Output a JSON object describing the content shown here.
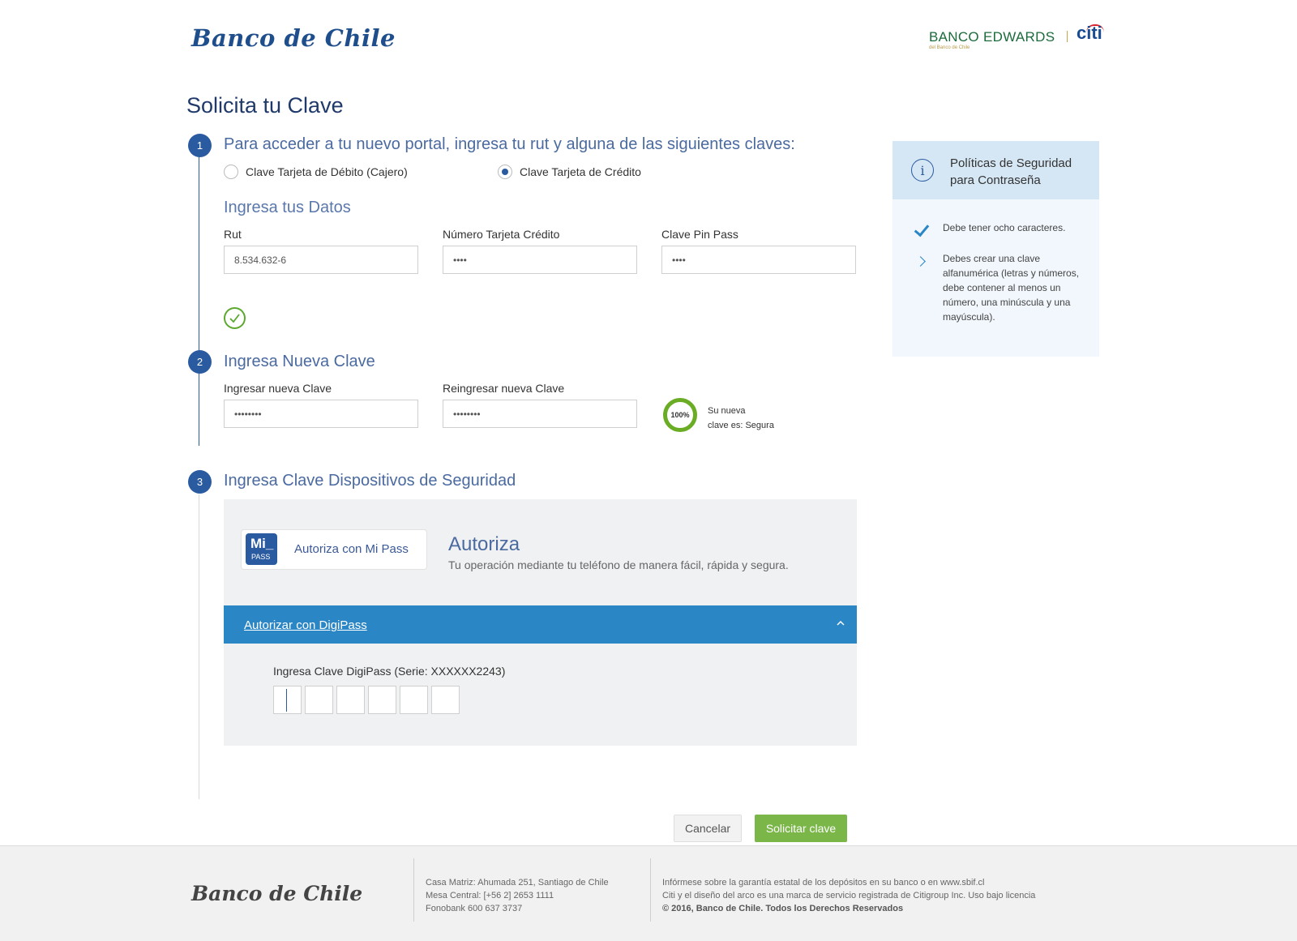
{
  "header": {
    "logo_left": "Banco de Chile",
    "logo_right_main": "BANCO EDWARDS",
    "logo_right_sub": "del Banco de Chile",
    "logo_citi": "citi"
  },
  "page_title": "Solicita tu Clave",
  "step1": {
    "number": "1",
    "heading": "Para acceder a tu nuevo portal, ingresa tu rut y alguna de las siguientes claves:",
    "options": [
      {
        "label": "Clave Tarjeta de Débito (Cajero)",
        "selected": false
      },
      {
        "label": "Clave Tarjeta de Crédito",
        "selected": true
      }
    ],
    "subheading": "Ingresa tus Datos",
    "fields": [
      {
        "label": "Rut",
        "value": "8.534.632-6"
      },
      {
        "label": "Número Tarjeta Crédito",
        "value": "••••"
      },
      {
        "label": "Clave Pin Pass",
        "value": "••••"
      }
    ]
  },
  "step2": {
    "number": "2",
    "heading": "Ingresa Nueva Clave",
    "fields": [
      {
        "label": "Ingresar nueva Clave",
        "value": "••••••••"
      },
      {
        "label": "Reingresar nueva Clave",
        "value": "••••••••"
      }
    ],
    "strength_percent": "100%",
    "strength_value": 1.0,
    "strength_text_line1": "Su nueva",
    "strength_text_line2": "clave es: Segura"
  },
  "step3": {
    "number": "3",
    "heading": "Ingresa Clave Dispositivos de Seguridad",
    "mipass_icon_top": "Mi_",
    "mipass_icon_bottom": "PASS",
    "mipass_button": "Autoriza con Mi Pass",
    "autoriza_title": "Autoriza",
    "autoriza_desc": "Tu operación mediante tu teléfono de manera fácil, rápida y segura.",
    "digipass_link": "Autorizar con DigiPass",
    "digipass_label": "Ingresa Clave DigiPass (Serie: XXXXXX2243)",
    "digipass_digits": [
      "",
      "",
      "",
      "",
      "",
      ""
    ]
  },
  "buttons": {
    "cancel": "Cancelar",
    "submit": "Solicitar clave"
  },
  "policy": {
    "title_line1": "Políticas de Seguridad",
    "title_line2": "para Contraseña",
    "item1": "Debe tener ocho caracteres.",
    "item2": "Debes crear una clave alfanumérica (letras y números, debe contener al menos un número, una minúscula y una mayúscula)."
  },
  "footer": {
    "logo": "Banco de Chile",
    "col1_line1": "Casa Matriz: Ahumada 251, Santiago de Chile",
    "col1_line2": "Mesa Central: [+56 2] 2653 1111",
    "col1_line3": "Fonobank 600 637 3737",
    "col2_line1": "Infórmese sobre la garantía estatal de los depósitos en su banco o en www.sbif.cl",
    "col2_line2": "Citi y el diseño del arco es una marca de servicio registrada de Citigroup Inc. Uso bajo licencia",
    "col2_line3": "© 2016, Banco de Chile. Todos los Derechos Reservados"
  },
  "colors": {
    "primary": "#2a5aa0",
    "digipass_bar": "#2b86c5",
    "submit": "#7ab648",
    "success": "#5ba82e"
  }
}
